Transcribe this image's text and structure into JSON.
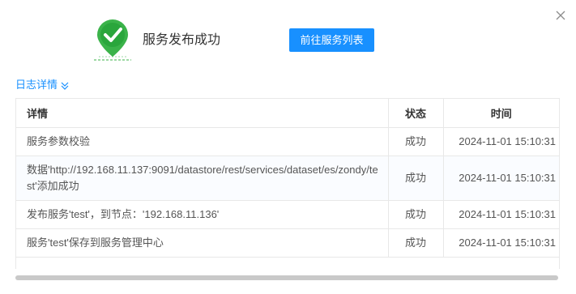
{
  "dialog": {
    "success_text": "服务发布成功",
    "goto_button_label": "前往服务列表",
    "log_toggle_label": "日志详情",
    "close_icon": "close-icon",
    "success_icon": "check-marker-icon",
    "accent_color": "#1890ff",
    "success_color": "#3bb34a"
  },
  "log_table": {
    "headers": {
      "detail": "详情",
      "status": "状态",
      "time": "时间"
    },
    "rows": [
      {
        "detail": "服务参数校验",
        "status": "成功",
        "time": "2024-11-01 15:10:31"
      },
      {
        "detail": "数据'http://192.168.11.137:9091/datastore/rest/services/dataset/es/zondy/test'添加成功",
        "status": "成功",
        "time": "2024-11-01 15:10:31"
      },
      {
        "detail": "发布服务'test'，到节点：'192.168.11.136'",
        "status": "成功",
        "time": "2024-11-01 15:10:31"
      },
      {
        "detail": "服务'test'保存到服务管理中心",
        "status": "成功",
        "time": "2024-11-01 15:10:31"
      }
    ]
  }
}
